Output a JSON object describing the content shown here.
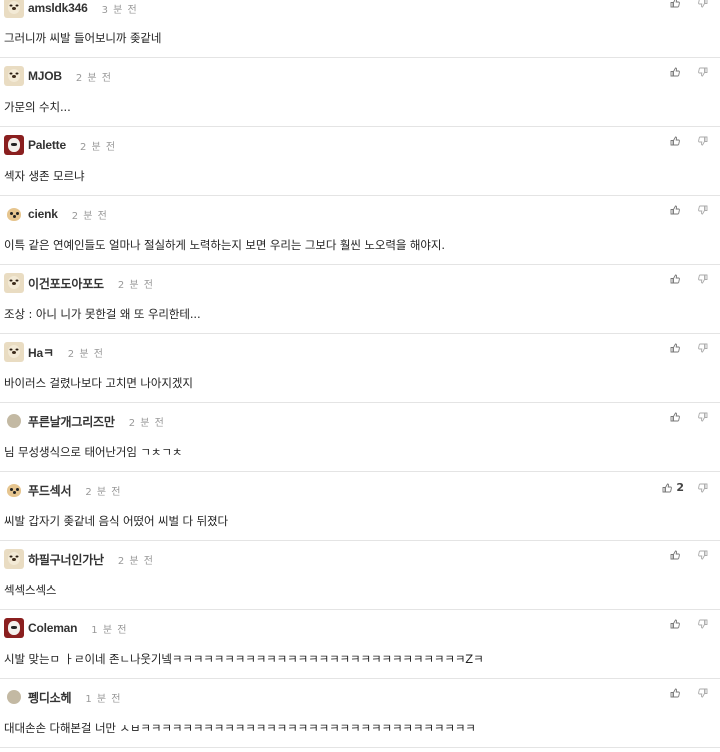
{
  "comments": [
    {
      "username": "amsldk346",
      "time": "3 분 전",
      "avatar": "dog",
      "text": "그러니까 씨발 들어보니까 좆같네",
      "likes": ""
    },
    {
      "username": "MJOB",
      "time": "2 분 전",
      "avatar": "dog",
      "text": "가문의 수치...",
      "likes": ""
    },
    {
      "username": "Palette",
      "time": "2 분 전",
      "avatar": "red",
      "text": "섹자 생존 모르냐",
      "likes": ""
    },
    {
      "username": "cienk",
      "time": "2 분 전",
      "avatar": "chi",
      "text": "이특 같은 연예인들도 얼마나 절실하게 노력하는지 보면 우리는 그보다 훨씬 노오력을 해야지.",
      "likes": ""
    },
    {
      "username": "이건포도아포도",
      "time": "2 분 전",
      "avatar": "dog",
      "text": "조상 : 아니 니가 못한걸 왜 또 우리한테...",
      "likes": ""
    },
    {
      "username": "Haㅋ",
      "time": "2 분 전",
      "avatar": "dog",
      "text": "바이러스 걸렸나보다 고치면 나아지겠지",
      "likes": ""
    },
    {
      "username": "푸른날개그리즈만",
      "time": "2 분 전",
      "avatar": "dot",
      "text": "님 무성생식으로 태어난거임 ㄱㅊㄱㅊ",
      "likes": ""
    },
    {
      "username": "푸드섹서",
      "time": "2 분 전",
      "avatar": "chi",
      "text": "씨발 갑자기 좆같네 음식 어떴어 씨벌 다 뒤졌다",
      "likes": "2"
    },
    {
      "username": "하필구너인가난",
      "time": "2 분 전",
      "avatar": "dog",
      "text": "섹섹스섹스",
      "likes": ""
    },
    {
      "username": "Coleman",
      "time": "1 분 전",
      "avatar": "red",
      "text": "시발 맞는ㅁ ㅏㄹ이네 존ㄴ나웃기넼ㅋㅋㅋㅋㅋㅋㅋㅋㅋㅋㅋㅋㅋㅋㅋㅋㅋㅋㅋㅋㅋㅋㅋㅋㅋㅋㅋㅋZㅋ",
      "likes": ""
    },
    {
      "username": "펭디소헤",
      "time": "1 분 전",
      "avatar": "dot",
      "text": "대대손손 다해본걸 너만 ㅅㅂㅋㅋㅋㅋㅋㅋㅋㅋㅋㅋㅋㅋㅋㅋㅋㅋㅋㅋㅋㅋㅋㅋㅋㅋㅋㅋㅋㅋㅋㅋㅋㅋ",
      "likes": ""
    }
  ]
}
